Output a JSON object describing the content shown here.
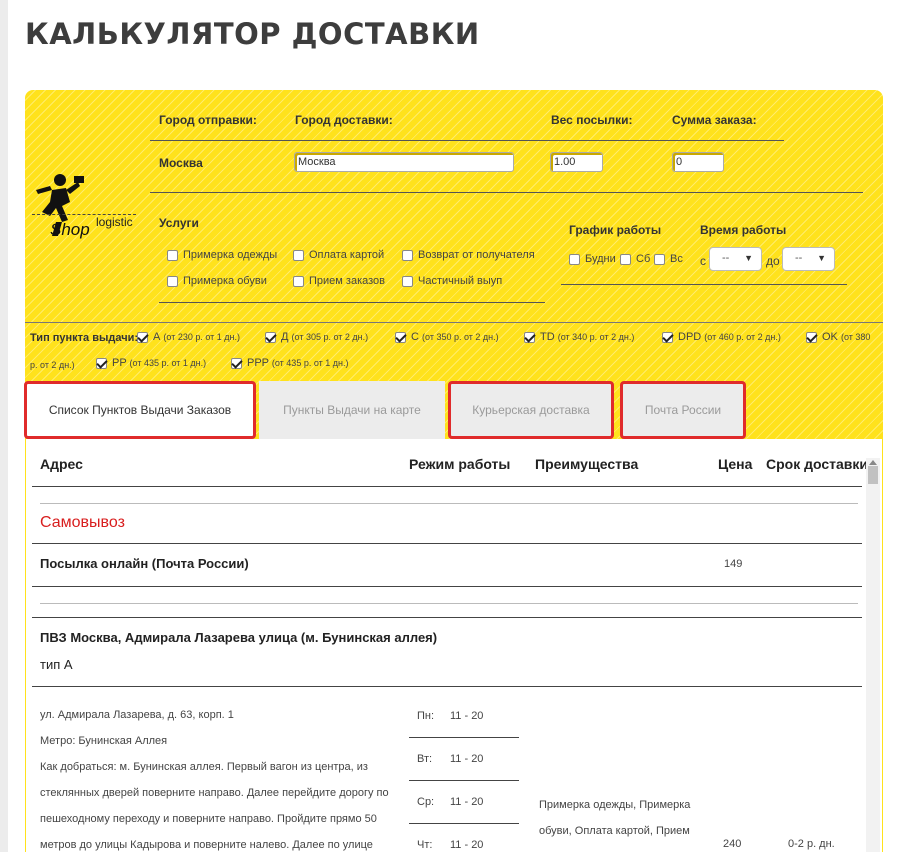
{
  "page_title": "КАЛЬКУЛЯТОР ДОСТАВКИ",
  "logo": {
    "text": "Shop",
    "sub": "logistic"
  },
  "form": {
    "from_label": "Город отправки:",
    "to_label": "Город доставки:",
    "weight_label": "Вес посылки:",
    "sum_label": "Сумма заказа:",
    "from_value": "Москва",
    "to_value": "Москва",
    "weight_value": "1.00",
    "sum_value": "0"
  },
  "services": {
    "title": "Услуги",
    "items": [
      "Примерка одежды",
      "Оплата картой",
      "Возврат от получателя",
      "Примерка обуви",
      "Прием заказов",
      "Частичный выуп"
    ]
  },
  "schedule": {
    "title": "График работы",
    "days": [
      "Будни",
      "Сб",
      "Вс"
    ],
    "time_title": "Время работы",
    "from_prefix": "с",
    "to_prefix": "до",
    "from_value": "--",
    "to_value": "--"
  },
  "pickup_types": {
    "label": "Тип пункта выдачи:",
    "items": [
      {
        "code": "А",
        "note": "(от 230 р. от 1 дн.)"
      },
      {
        "code": "Д",
        "note": "(от 305 р. от 2 дн.)"
      },
      {
        "code": "С",
        "note": "(от 350 р. от 2 дн.)"
      },
      {
        "code": "TD",
        "note": "(от 340 р. от 2 дн.)"
      },
      {
        "code": "DPD",
        "note": "(от 460 р. от 2 дн.)"
      },
      {
        "code": "OK",
        "note": "(от 380"
      },
      {
        "code": "",
        "note": "р. от 2 дн.)"
      },
      {
        "code": "PP",
        "note": "(от 435 р. от 1 дн.)"
      },
      {
        "code": "PPP",
        "note": "(от 435 р. от 1 дн.)"
      }
    ]
  },
  "tabs": [
    "Список Пунктов Выдачи Заказов",
    "Пункты Выдачи на карте",
    "Курьерская доставка",
    "Почта России"
  ],
  "table": {
    "headers": [
      "Адрес",
      "Режим работы",
      "Преимущества",
      "Цена",
      "Срок доставки"
    ],
    "section_title": "Самовывоз",
    "online_row": {
      "name": "Посылка онлайн (Почта России)",
      "price": "149"
    },
    "point": {
      "name": "ПВЗ Москва, Адмирала Лазарева улица (м. Бунинская аллея)",
      "type": "тип А",
      "address": "ул. Адмирала Лазарева, д. 63, корп. 1",
      "metro": "Метро: Бунинская Аллея",
      "directions": [
        "Как добраться: м. Бунинская аллея. Первый вагон из центра, из",
        "стеклянных дверей поверните направо. Далее перейдите дорогу по",
        "пешеходному переходу и поверните направо. Пройдите прямо 50",
        "метров до улицы Кадырова и поверните налево. Далее по улице"
      ],
      "hours": [
        {
          "day": "Пн:",
          "time": "11 - 20"
        },
        {
          "day": "Вт:",
          "time": "11 - 20"
        },
        {
          "day": "Ср:",
          "time": "11 - 20"
        },
        {
          "day": "Чт:",
          "time": "11 - 20"
        }
      ],
      "benefits": [
        "Примерка одежды, Примерка",
        "обуви, Оплата картой, Прием"
      ],
      "price": "240",
      "term": "0-2 р. дн."
    }
  }
}
